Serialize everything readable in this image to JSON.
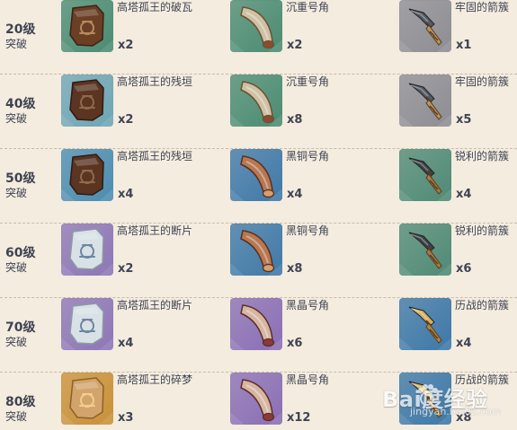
{
  "rows": [
    {
      "level": "20级",
      "phase": "突破",
      "items": [
        {
          "name": "高塔孤王的破瓦",
          "qty": "x2",
          "icon": "ruined-tile-icon",
          "color": "#4b8c73"
        },
        {
          "name": "沉重号角",
          "qty": "x2",
          "icon": "heavy-horn-icon",
          "color": "#4b8c73"
        },
        {
          "name": "牢固的箭簇",
          "qty": "x1",
          "icon": "firm-arrowhead-icon",
          "color": "#8d8d94"
        }
      ]
    },
    {
      "level": "40级",
      "phase": "突破",
      "items": [
        {
          "name": "高塔孤王的残垣",
          "qty": "x2",
          "icon": "ruined-wall-icon",
          "color": "#6ea5b5"
        },
        {
          "name": "沉重号角",
          "qty": "x8",
          "icon": "heavy-horn-icon",
          "color": "#4b8c73"
        },
        {
          "name": "牢固的箭簇",
          "qty": "x5",
          "icon": "firm-arrowhead-icon",
          "color": "#8d8d94"
        }
      ]
    },
    {
      "level": "50级",
      "phase": "突破",
      "items": [
        {
          "name": "高塔孤王的残垣",
          "qty": "x4",
          "icon": "ruined-wall-icon",
          "color": "#4c8db1"
        },
        {
          "name": "黑铜号角",
          "qty": "x4",
          "icon": "black-bronze-horn-icon",
          "color": "#3f79a8"
        },
        {
          "name": "锐利的箭簇",
          "qty": "x4",
          "icon": "sharp-arrowhead-icon",
          "color": "#4f8a76"
        }
      ]
    },
    {
      "level": "60级",
      "phase": "突破",
      "items": [
        {
          "name": "高塔孤王的断片",
          "qty": "x2",
          "icon": "fragment-icon",
          "color": "#8d76b6"
        },
        {
          "name": "黑铜号角",
          "qty": "x8",
          "icon": "black-bronze-horn-icon",
          "color": "#3f79a8"
        },
        {
          "name": "锐利的箭簇",
          "qty": "x6",
          "icon": "sharp-arrowhead-icon",
          "color": "#4f8a76"
        }
      ]
    },
    {
      "level": "70级",
      "phase": "突破",
      "items": [
        {
          "name": "高塔孤王的断片",
          "qty": "x4",
          "icon": "fragment-icon",
          "color": "#8d76b6"
        },
        {
          "name": "黑晶号角",
          "qty": "x6",
          "icon": "black-crystal-horn-icon",
          "color": "#8a6fb5"
        },
        {
          "name": "历战的箭簇",
          "qty": "x4",
          "icon": "weathered-arrowhead-icon",
          "color": "#3d78a8"
        }
      ]
    },
    {
      "level": "80级",
      "phase": "突破",
      "items": [
        {
          "name": "高塔孤王的碎梦",
          "qty": "x3",
          "icon": "shattered-dream-icon",
          "color": "#c99139"
        },
        {
          "name": "黑晶号角",
          "qty": "x12",
          "icon": "black-crystal-horn-icon",
          "color": "#8a6fb5"
        },
        {
          "name": "历战的箭簇",
          "qty": "x8",
          "icon": "weathered-arrowhead-icon",
          "color": "#3d78a8"
        }
      ]
    }
  ],
  "watermark": {
    "brand": "Bai度经验",
    "site": "jingyan.baidu.com"
  }
}
